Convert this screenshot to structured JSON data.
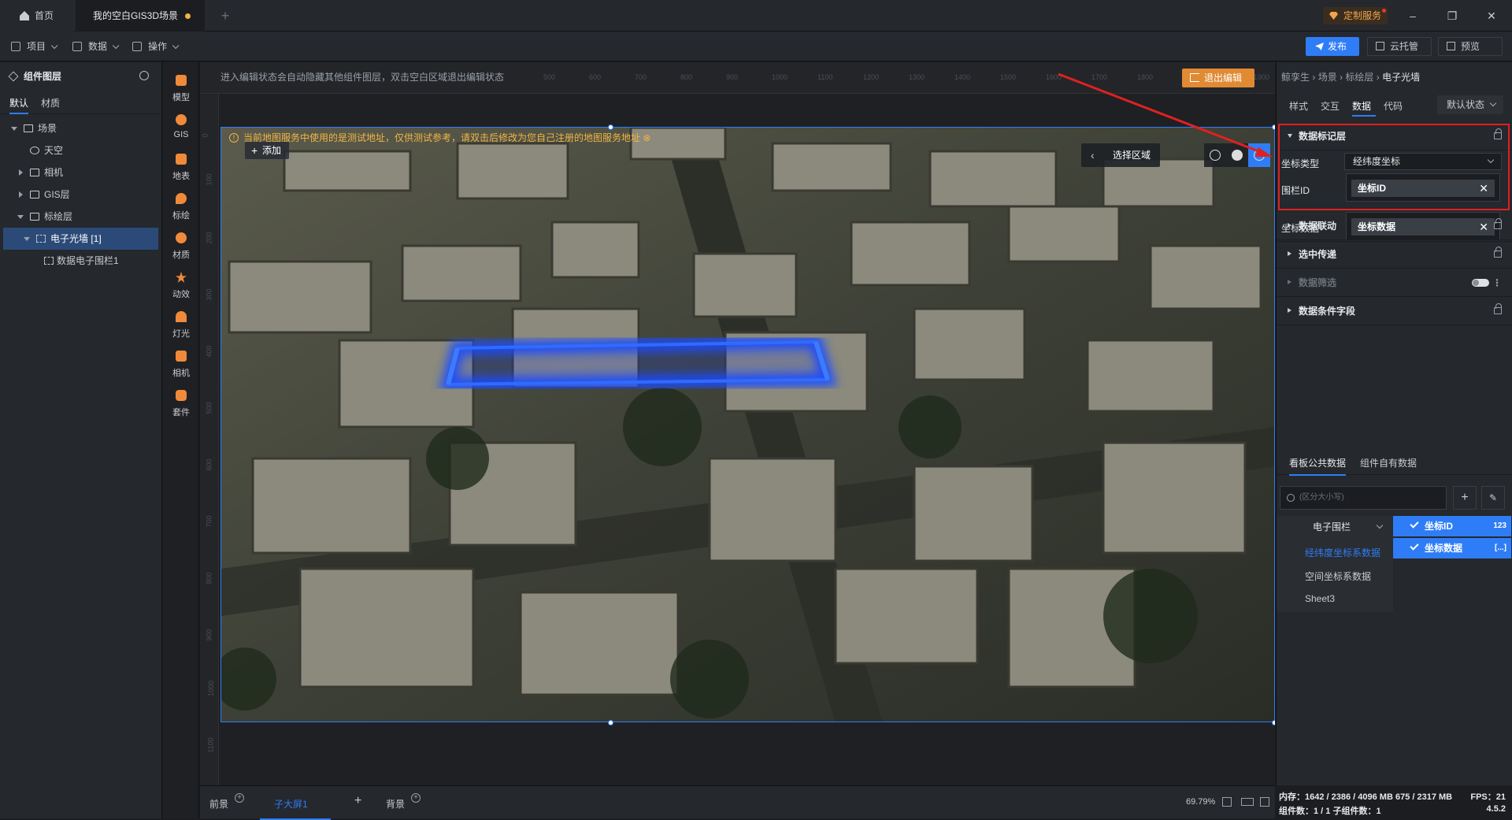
{
  "tabs": {
    "home": "首页",
    "scene": "我的空白GIS3D场景",
    "plus": "+"
  },
  "service": "定制服务",
  "window": {
    "min": "–",
    "max": "❐",
    "close": "✕"
  },
  "menu": {
    "project": "项目",
    "data": "数据",
    "ops": "操作"
  },
  "toolbar": {
    "publish": "发布",
    "cloud": "云托管",
    "preview": "预览"
  },
  "layers": {
    "title": "组件图层",
    "tab_default": "默认",
    "tab_material": "材质",
    "tree": [
      {
        "label": "场景"
      },
      {
        "label": "天空"
      },
      {
        "label": "相机"
      },
      {
        "label": "GIS层"
      },
      {
        "label": "标绘层"
      },
      {
        "label": "电子光墙 [1]"
      },
      {
        "label": "数据电子围栏1"
      }
    ]
  },
  "sideicons": [
    {
      "label": "模型",
      "icon": "cube-icon"
    },
    {
      "label": "GIS",
      "icon": "globe-icon"
    },
    {
      "label": "地表",
      "icon": "terrain-icon"
    },
    {
      "label": "标绘",
      "icon": "pin-icon"
    },
    {
      "label": "材质",
      "icon": "material-icon"
    },
    {
      "label": "动效",
      "icon": "star-icon"
    },
    {
      "label": "灯光",
      "icon": "light-icon"
    },
    {
      "label": "相机",
      "icon": "camera-icon"
    },
    {
      "label": "套件",
      "icon": "kit-icon"
    }
  ],
  "canvas": {
    "hint": "进入编辑状态会自动隐藏其他组件图层，双击空白区域退出编辑状态",
    "exit": "退出编辑",
    "warning": "当前地图服务中使用的是测试地址，仅供测试参考，请双击后修改为您自己注册的地图服务地址",
    "add": "添加",
    "select_region": "选择区域",
    "ruler_top": [
      "500",
      "600",
      "700",
      "800",
      "900",
      "1000",
      "1100",
      "1200",
      "1300",
      "1400",
      "1500",
      "1600",
      "1700",
      "1800",
      "1900"
    ],
    "ruler_left": [
      "0",
      "100",
      "200",
      "300",
      "400",
      "500",
      "600",
      "700",
      "800",
      "900",
      "1000",
      "1100"
    ]
  },
  "bottom": {
    "front": "前景",
    "sub": "子大屏1",
    "bg": "背景",
    "zoom": "69.79%"
  },
  "right": {
    "crumb": [
      "鲸孪生",
      "场景",
      "标绘层"
    ],
    "crumb_last": "电子光墙",
    "tabs": [
      "样式",
      "交互",
      "数据",
      "代码"
    ],
    "state": "默认状态",
    "sections": {
      "mark": "数据标记层",
      "link": "数据联动",
      "pass": "选中传递",
      "filter": "数据筛选",
      "cond": "数据条件字段"
    },
    "fields": {
      "coord_type_label": "坐标类型",
      "coord_type": "经纬度坐标",
      "fence_label": "围栏ID",
      "fence_value": "坐标ID",
      "coord_label": "坐标数据",
      "coord_value": "坐标数据"
    },
    "data_tabs": [
      "看板公共数据",
      "组件自有数据"
    ],
    "search_placeholder": "(区分大小写)",
    "group": "电子围栏",
    "items": [
      "经纬度坐标系数据",
      "空间坐标系数据",
      "Sheet3"
    ],
    "fields_list": [
      {
        "name": "坐标ID",
        "type": "123"
      },
      {
        "name": "坐标数据",
        "type": "[...]"
      }
    ]
  },
  "status": {
    "mem": "内存：1642 / 2386 / 4096 MB  675 / 2317 MB",
    "fps": "FPS：21",
    "count": "组件数：1 / 1   子组件数：1",
    "version": "4.5.2"
  }
}
